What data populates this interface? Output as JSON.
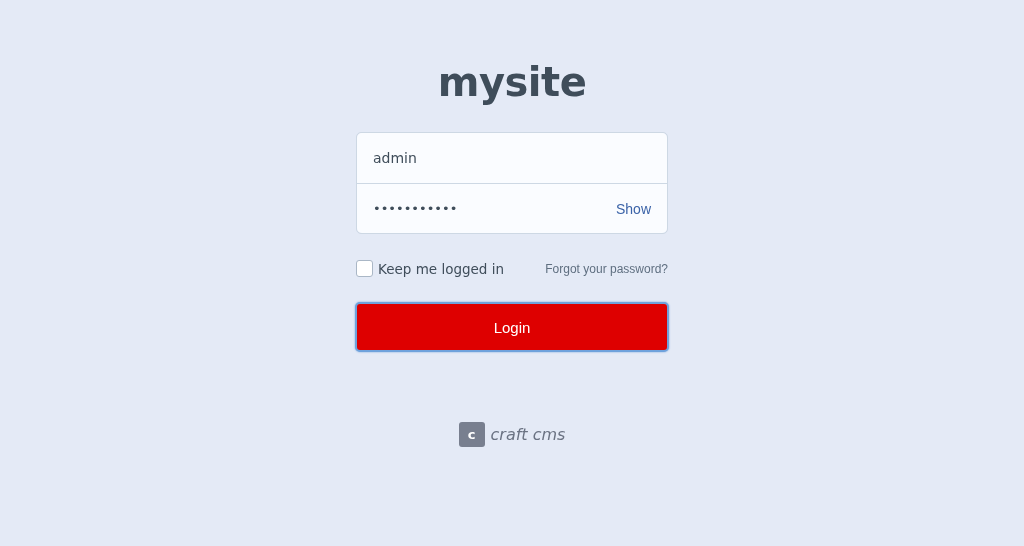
{
  "site_title": "mysite",
  "username": {
    "value": "admin"
  },
  "password": {
    "value": "•••••••••••",
    "toggle": "Show"
  },
  "remember": {
    "label": "Keep me logged in",
    "checked": false
  },
  "forgot_link": "Forgot your password?",
  "login_button": "Login",
  "footer": {
    "logo_letter": "c",
    "brand": "craft cms"
  }
}
